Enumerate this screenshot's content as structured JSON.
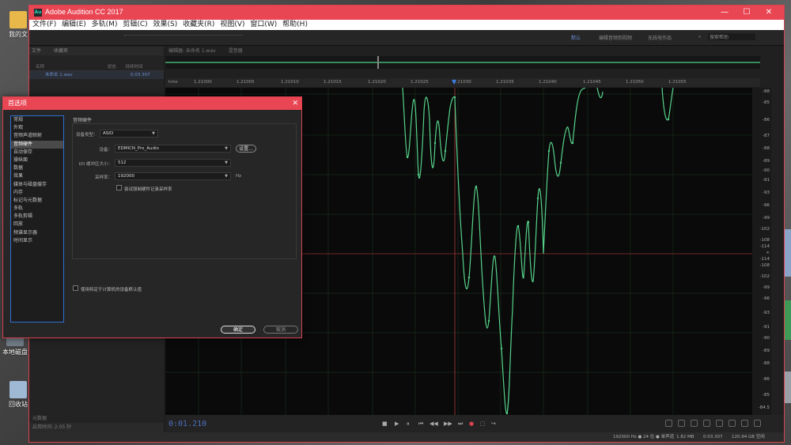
{
  "desktop": {
    "icons": [
      {
        "label": "我的文",
        "color": "#e9b84a"
      },
      {
        "label": "本地磁盘",
        "color": "#6f7a86"
      },
      {
        "label": "回收站",
        "color": "#9fb8d4"
      }
    ]
  },
  "window": {
    "title": "Adobe Audition CC 2017",
    "logo": "Au",
    "accent": "#e94654",
    "controls": {
      "minimize": "—",
      "maximize": "☐",
      "close": "✕"
    }
  },
  "menu": [
    "文件(F)",
    "编辑(E)",
    "多轨(M)",
    "剪辑(C)",
    "效果(S)",
    "收藏夹(R)",
    "视图(V)",
    "窗口(W)",
    "帮助(H)"
  ],
  "workspaces": [
    "默认",
    "编辑音频到视频",
    "无线电作品"
  ],
  "search_placeholder": "搜索帮助",
  "files_panel": {
    "tabs": [
      "文件",
      "收藏夹"
    ],
    "columns": [
      "名称",
      "状态",
      "持续时间"
    ],
    "rows": [
      {
        "name": "未命名 1.wav",
        "duration": "0:03.307"
      }
    ],
    "footer": "启用时间: 2.05 秒",
    "metadata_label": "元数据"
  },
  "editor": {
    "tabs": [
      "编辑器: 未命名 1.wav",
      "混音器"
    ],
    "ruler_unit": "hms",
    "ruler_ticks": [
      "1.21000",
      "1.21005",
      "1.21010",
      "1.21015",
      "1.21020",
      "1.21025",
      "1.21030",
      "1.21035",
      "1.21040",
      "1.21045",
      "1.21050",
      "1.21055"
    ],
    "db_scale": [
      "-88",
      "-85",
      "-86",
      "-87",
      "-88",
      "-89",
      "-90",
      "-91",
      "-93",
      "-96",
      "-99",
      "-102",
      "-108",
      "-114",
      "∞",
      "-114",
      "-108",
      "-102",
      "-99",
      "-96",
      "-93",
      "-91",
      "-90",
      "-89",
      "-88",
      "-86",
      "-85",
      "-84.5"
    ],
    "timecode": "0:01.210",
    "transport": [
      "■",
      "▶",
      "⏸",
      "⏮",
      "◀◀",
      "▶▶",
      "⏭",
      "●",
      "⬚",
      "↪"
    ]
  },
  "status_bar": {
    "format": "192000 Hz ● 24 位 ● 单声道",
    "size": "1.82 MB",
    "duration": "0:03.307",
    "free": "120.94 GB 空闲"
  },
  "dialog": {
    "title": "首选项",
    "close": "✕",
    "categories": [
      "常规",
      "外观",
      "音频声道映射",
      "音频硬件",
      "自动保存",
      "操纵面",
      "数据",
      "效果",
      "媒体与磁盘缓存",
      "内存",
      "标记与元数据",
      "多轨",
      "多轨剪辑",
      "回放",
      "频谱显示器",
      "时间显示"
    ],
    "selected_category": "音频硬件",
    "group_title": "音频硬件",
    "device_class_label": "设备类型：",
    "device_class_value": "ASIO",
    "device_label": "设备：",
    "device_value": "EDMICN_Pro_Audio",
    "settings_button": "设置...",
    "buffer_label": "I/O 缓冲区大小：",
    "buffer_value": "512",
    "sample_rate_label": "采样率：",
    "sample_rate_value": "192000",
    "sample_rate_unit": "Hz",
    "force_rate_label": "尝试强制硬件记录采样率",
    "use_system_default_label": "使用特定于计算机的设备默认值",
    "ok_label": "确定",
    "cancel_label": "取消"
  }
}
